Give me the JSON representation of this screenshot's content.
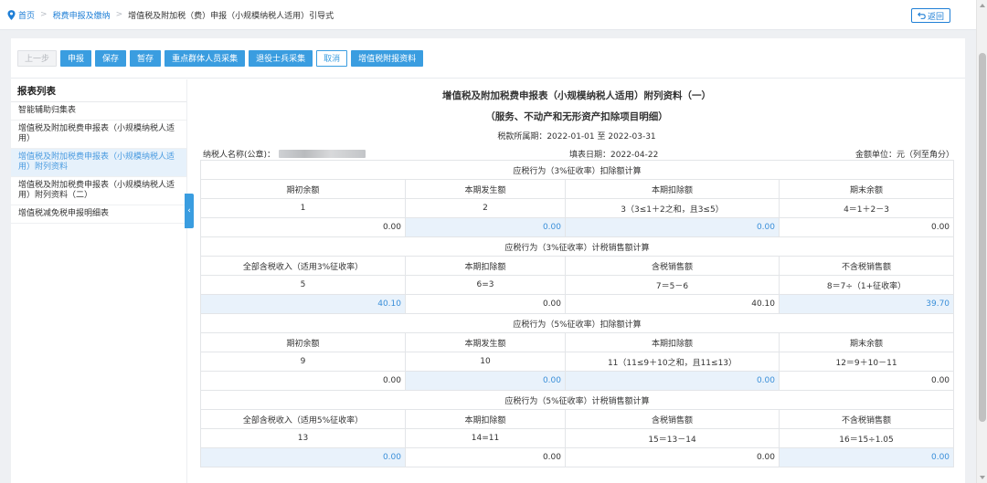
{
  "breadcrumb": {
    "home": "首页",
    "section": "税费申报及缴纳",
    "current": "增值税及附加税（费）申报（小规模纳税人适用）引导式",
    "back_label": "返回"
  },
  "toolbar": {
    "prev": "上一步",
    "declare": "申报",
    "save": "保存",
    "temp_save": "暂存",
    "key_group": "重点群体人员采集",
    "veteran": "退役士兵采集",
    "cancel": "取消",
    "vat_attach": "增值税附报资料"
  },
  "sidebar": {
    "title": "报表列表",
    "items": [
      {
        "label": "智能辅助归集表"
      },
      {
        "label": "增值税及附加税费申报表（小规模纳税人适用）"
      },
      {
        "label": "增值税及附加税费申报表（小规模纳税人适用）附列资料"
      },
      {
        "label": "增值税及附加税费申报表（小规模纳税人适用）附列资料（二）"
      },
      {
        "label": "增值税减免税申报明细表"
      }
    ],
    "collapse_icon": "‹"
  },
  "form": {
    "title": "增值税及附加税费申报表（小规模纳税人适用）附列资料（一）",
    "subtitle": "（服务、不动产和无形资产扣除项目明细）",
    "period_label": "税款所属期：",
    "period": "2022-01-01 至 2022-03-31",
    "taxpayer_label": "纳税人名称(公章)：",
    "fill_date_label": "填表日期：",
    "fill_date": "2022-04-22",
    "unit_label": "金额单位：元（列至角分）"
  },
  "sections": [
    {
      "header": "应税行为（3%征收率）扣除额计算",
      "cols": [
        "期初余额",
        "本期发生额",
        "本期扣除额",
        "期末余额"
      ],
      "nums": [
        "1",
        "2",
        "3（3≤1＋2之和，且3≤5）",
        "4＝1＋2－3"
      ],
      "values": [
        "0.00",
        "0.00",
        "0.00",
        "0.00"
      ]
    },
    {
      "header": "应税行为（3%征收率）计税销售额计算",
      "cols": [
        "全部含税收入（适用3%征收率）",
        "本期扣除额",
        "含税销售额",
        "不含税销售额"
      ],
      "nums": [
        "5",
        "6=3",
        "7＝5－6",
        "8＝7÷（1+征收率）"
      ],
      "values": [
        "40.10",
        "0.00",
        "40.10",
        "39.70"
      ]
    },
    {
      "header": "应税行为（5%征收率）扣除额计算",
      "cols": [
        "期初余额",
        "本期发生额",
        "本期扣除额",
        "期末余额"
      ],
      "nums": [
        "9",
        "10",
        "11（11≤9＋10之和，且11≤13）",
        "12＝9＋10－11"
      ],
      "values": [
        "0.00",
        "0.00",
        "0.00",
        "0.00"
      ]
    },
    {
      "header": "应税行为（5%征收率）计税销售额计算",
      "cols": [
        "全部含税收入（适用5%征收率）",
        "本期扣除额",
        "含税销售额",
        "不含税销售额"
      ],
      "nums": [
        "13",
        "14=11",
        "15＝13－14",
        "16＝15÷1.05"
      ],
      "values": [
        "0.00",
        "0.00",
        "0.00",
        "0.00"
      ]
    }
  ],
  "editable_cells": [
    [
      false,
      true,
      true,
      false
    ],
    [
      true,
      false,
      false,
      true
    ],
    [
      false,
      true,
      true,
      false
    ],
    [
      true,
      false,
      false,
      true
    ]
  ]
}
